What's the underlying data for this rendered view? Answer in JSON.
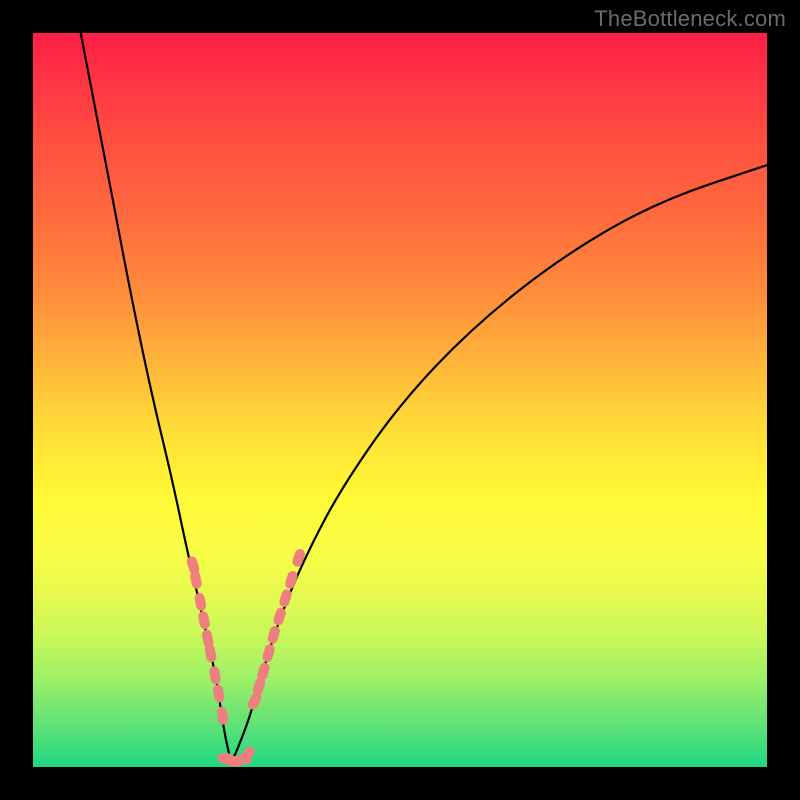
{
  "watermark": "TheBottleneck.com",
  "colors": {
    "frame": "#000000",
    "curve": "#000000",
    "dots": "#ef7e7e",
    "gradient_top": "#ff1e45",
    "gradient_bottom": "#1ed882"
  },
  "chart_data": {
    "type": "line",
    "title": "",
    "xlabel": "",
    "ylabel": "",
    "xlim": [
      0,
      100
    ],
    "ylim": [
      0,
      100
    ],
    "note": "V-shaped bottleneck curve over a vertical rainbow-gradient background (red=high bottleneck at top, green=low at bottom). The curve minimum is near x≈27, y≈0. Salmon dots mark sampled hardware points clustered near the minimum on both arms. Values are estimated from pixel positions; the image carries no axis ticks or numeric labels.",
    "series": [
      {
        "name": "bottleneck-curve-left-arm",
        "x": [
          6.5,
          10,
          13,
          16,
          19,
          21,
          23,
          25,
          26,
          27
        ],
        "y": [
          100,
          82,
          66,
          51.5,
          39,
          29.5,
          21,
          12,
          5,
          0.5
        ]
      },
      {
        "name": "bottleneck-curve-right-arm",
        "x": [
          27,
          29,
          31,
          33.5,
          37,
          42,
          50,
          60,
          72,
          85,
          100
        ],
        "y": [
          0.5,
          5,
          12,
          20,
          28.5,
          38,
          49.5,
          60,
          69.5,
          77,
          82
        ]
      },
      {
        "name": "sample-points-left-arm",
        "x": [
          21.8,
          22.2,
          22.8,
          23.3,
          23.8,
          24.2,
          24.8,
          25.3,
          25.8
        ],
        "y": [
          27.5,
          25.5,
          22.5,
          20,
          17.5,
          15.5,
          12.5,
          10,
          7
        ]
      },
      {
        "name": "sample-points-valley",
        "x": [
          26.2,
          26.8,
          27.4,
          28.0,
          28.7,
          29.3
        ],
        "y": [
          1.2,
          0.9,
          0.8,
          0.9,
          1.0,
          1.8
        ]
      },
      {
        "name": "sample-points-right-arm",
        "x": [
          30.2,
          30.8,
          31.4,
          32.1,
          32.8,
          33.6,
          34.4,
          35.2,
          36.2
        ],
        "y": [
          9,
          11,
          13,
          15.5,
          18,
          20.5,
          23,
          25.5,
          28.5
        ]
      }
    ]
  }
}
